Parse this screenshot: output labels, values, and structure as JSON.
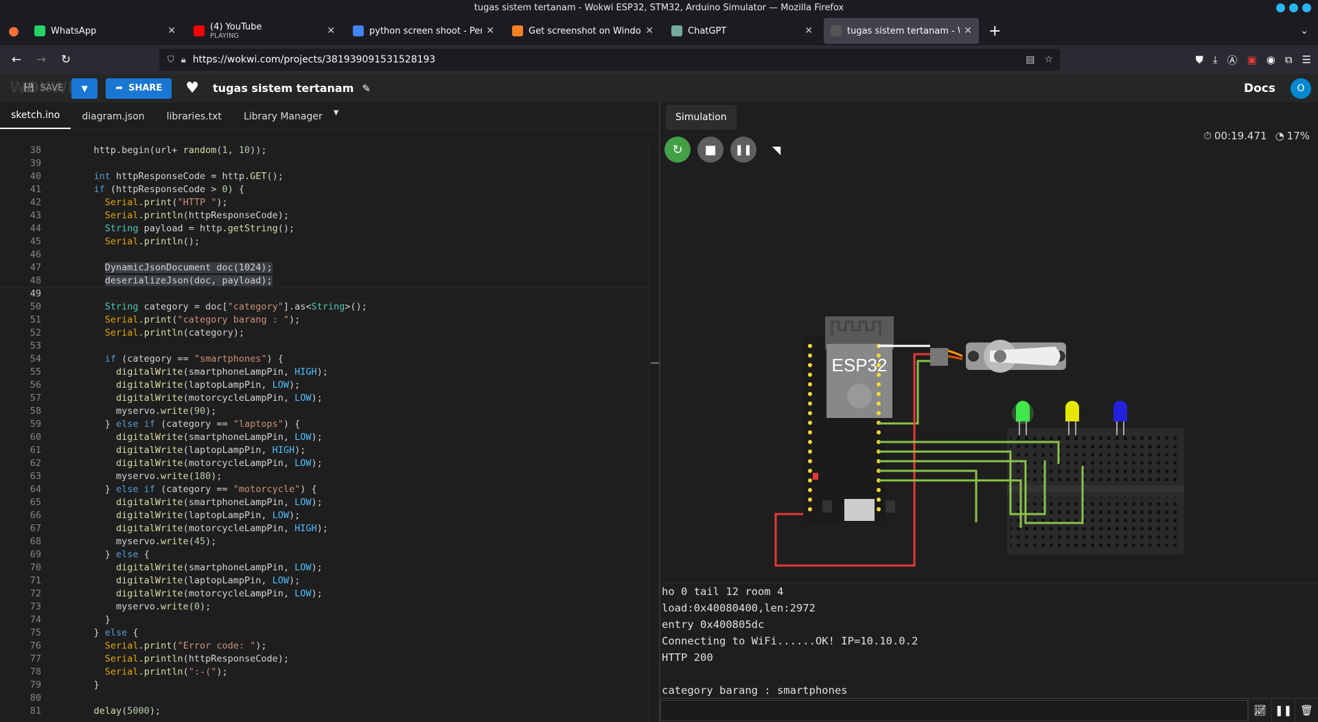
{
  "window": {
    "title": "tugas sistem tertanam - Wokwi ESP32, STM32, Arduino Simulator — Mozilla Firefox"
  },
  "tabs": [
    {
      "label": "WhatsApp",
      "icon": "whatsapp-icon",
      "color": "#25d366"
    },
    {
      "label": "(4) YouTube",
      "sub": "PLAYING",
      "icon": "youtube-icon",
      "color": "#ff0000"
    },
    {
      "label": "python screen shoot - Pen",
      "icon": "google-icon",
      "color": "#4285f4"
    },
    {
      "label": "Get screenshot on Window",
      "icon": "stackoverflow-icon",
      "color": "#f48024"
    },
    {
      "label": "ChatGPT",
      "icon": "chatgpt-icon",
      "color": "#74aa9c"
    },
    {
      "label": "tugas sistem tertanam - W",
      "icon": "wokwi-icon",
      "color": "#555555"
    }
  ],
  "url": "https://wokwi.com/projects/381939091531528193",
  "header": {
    "logo": "WOKWI",
    "save_label": "SAVE",
    "share_label": "SHARE",
    "project_title": "tugas sistem tertanam",
    "docs_label": "Docs",
    "avatar_letter": "O"
  },
  "editor_tabs": [
    "sketch.ino",
    "diagram.json",
    "libraries.txt",
    "Library Manager"
  ],
  "sim_tab": "Simulation",
  "timer": "00:19.471",
  "speed": "17%",
  "esp_label": "ESP32",
  "serial_lines": [
    "ho 0 tail 12 room 4",
    "load:0x40080400,len:2972",
    "entry 0x400805dc",
    "Connecting to WiFi......OK! IP=10.10.0.2",
    "HTTP 200",
    "",
    "category barang : smartphones"
  ],
  "code_start": 38,
  "code_lines": [
    [
      [
        "",
        "    http.begin(url+ "
      ],
      [
        "fn",
        "random"
      ],
      [
        "",
        "("
      ],
      [
        "num",
        "1"
      ],
      [
        "",
        ", "
      ],
      [
        "num",
        "10"
      ],
      [
        "",
        "));"
      ]
    ],
    [],
    [
      [
        "kw",
        "    int"
      ],
      [
        "",
        " httpResponseCode = http."
      ],
      [
        "fn",
        "GET"
      ],
      [
        "",
        "();"
      ]
    ],
    [
      [
        "kw",
        "    if"
      ],
      [
        "",
        " (httpResponseCode > "
      ],
      [
        "num",
        "0"
      ],
      [
        "",
        ") {"
      ]
    ],
    [
      [
        "obj",
        "      Serial"
      ],
      [
        "",
        "."
      ],
      [
        "fn",
        "print"
      ],
      [
        "",
        "("
      ],
      [
        "str",
        "\"HTTP \""
      ],
      [
        "",
        ");"
      ]
    ],
    [
      [
        "obj",
        "      Serial"
      ],
      [
        "",
        "."
      ],
      [
        "fn",
        "println"
      ],
      [
        "",
        "(httpResponseCode);"
      ]
    ],
    [
      [
        "ty",
        "      String"
      ],
      [
        "",
        " payload = http."
      ],
      [
        "fn",
        "getString"
      ],
      [
        "",
        "();"
      ]
    ],
    [
      [
        "obj",
        "      Serial"
      ],
      [
        "",
        "."
      ],
      [
        "fn",
        "println"
      ],
      [
        "",
        "();"
      ]
    ],
    [],
    [
      [
        "sel",
        "      DynamicJsonDocument doc(1024);"
      ]
    ],
    [
      [
        "sel",
        "      deserializeJson(doc, payload);"
      ]
    ],
    [],
    [
      [
        "ty",
        "      String"
      ],
      [
        "",
        " category = doc["
      ],
      [
        "str",
        "\"category\""
      ],
      [
        "",
        "].as<"
      ],
      [
        "ty",
        "String"
      ],
      [
        "",
        ">();"
      ]
    ],
    [
      [
        "obj",
        "      Serial"
      ],
      [
        "",
        "."
      ],
      [
        "fn",
        "print"
      ],
      [
        "",
        "("
      ],
      [
        "str",
        "\"category barang : \""
      ],
      [
        "",
        ");"
      ]
    ],
    [
      [
        "obj",
        "      Serial"
      ],
      [
        "",
        "."
      ],
      [
        "fn",
        "println"
      ],
      [
        "",
        "(category);"
      ]
    ],
    [],
    [
      [
        "kw",
        "      if"
      ],
      [
        "",
        " (category == "
      ],
      [
        "str",
        "\"smartphones\""
      ],
      [
        "",
        ") {"
      ]
    ],
    [
      [
        "fn",
        "        digitalWrite"
      ],
      [
        "",
        "(smartphoneLampPin, "
      ],
      [
        "cn",
        "HIGH"
      ],
      [
        "",
        ");"
      ]
    ],
    [
      [
        "fn",
        "        digitalWrite"
      ],
      [
        "",
        "(laptopLampPin, "
      ],
      [
        "cn",
        "LOW"
      ],
      [
        "",
        ");"
      ]
    ],
    [
      [
        "fn",
        "        digitalWrite"
      ],
      [
        "",
        "(motorcycleLampPin, "
      ],
      [
        "cn",
        "LOW"
      ],
      [
        "",
        ");"
      ]
    ],
    [
      [
        "",
        "        myservo."
      ],
      [
        "fn",
        "write"
      ],
      [
        "",
        "("
      ],
      [
        "num",
        "90"
      ],
      [
        "",
        ");"
      ]
    ],
    [
      [
        "",
        "      } "
      ],
      [
        "kw",
        "else if"
      ],
      [
        "",
        " (category == "
      ],
      [
        "str",
        "\"laptops\""
      ],
      [
        "",
        ") {"
      ]
    ],
    [
      [
        "fn",
        "        digitalWrite"
      ],
      [
        "",
        "(smartphoneLampPin, "
      ],
      [
        "cn",
        "LOW"
      ],
      [
        "",
        ");"
      ]
    ],
    [
      [
        "fn",
        "        digitalWrite"
      ],
      [
        "",
        "(laptopLampPin, "
      ],
      [
        "cn",
        "HIGH"
      ],
      [
        "",
        ");"
      ]
    ],
    [
      [
        "fn",
        "        digitalWrite"
      ],
      [
        "",
        "(motorcycleLampPin, "
      ],
      [
        "cn",
        "LOW"
      ],
      [
        "",
        ");"
      ]
    ],
    [
      [
        "",
        "        myservo."
      ],
      [
        "fn",
        "write"
      ],
      [
        "",
        "("
      ],
      [
        "num",
        "180"
      ],
      [
        "",
        ");"
      ]
    ],
    [
      [
        "",
        "      } "
      ],
      [
        "kw",
        "else if"
      ],
      [
        "",
        " (category == "
      ],
      [
        "str",
        "\"motorcycle\""
      ],
      [
        "",
        ") {"
      ]
    ],
    [
      [
        "fn",
        "        digitalWrite"
      ],
      [
        "",
        "(smartphoneLampPin, "
      ],
      [
        "cn",
        "LOW"
      ],
      [
        "",
        ");"
      ]
    ],
    [
      [
        "fn",
        "        digitalWrite"
      ],
      [
        "",
        "(laptopLampPin, "
      ],
      [
        "cn",
        "LOW"
      ],
      [
        "",
        ");"
      ]
    ],
    [
      [
        "fn",
        "        digitalWrite"
      ],
      [
        "",
        "(motorcycleLampPin, "
      ],
      [
        "cn",
        "HIGH"
      ],
      [
        "",
        ");"
      ]
    ],
    [
      [
        "",
        "        myservo."
      ],
      [
        "fn",
        "write"
      ],
      [
        "",
        "("
      ],
      [
        "num",
        "45"
      ],
      [
        "",
        ");"
      ]
    ],
    [
      [
        "",
        "      } "
      ],
      [
        "kw",
        "else"
      ],
      [
        "",
        " {"
      ]
    ],
    [
      [
        "fn",
        "        digitalWrite"
      ],
      [
        "",
        "(smartphoneLampPin, "
      ],
      [
        "cn",
        "LOW"
      ],
      [
        "",
        ");"
      ]
    ],
    [
      [
        "fn",
        "        digitalWrite"
      ],
      [
        "",
        "(laptopLampPin, "
      ],
      [
        "cn",
        "LOW"
      ],
      [
        "",
        ");"
      ]
    ],
    [
      [
        "fn",
        "        digitalWrite"
      ],
      [
        "",
        "(motorcycleLampPin, "
      ],
      [
        "cn",
        "LOW"
      ],
      [
        "",
        ");"
      ]
    ],
    [
      [
        "",
        "        myservo."
      ],
      [
        "fn",
        "write"
      ],
      [
        "",
        "("
      ],
      [
        "num",
        "0"
      ],
      [
        "",
        ");"
      ]
    ],
    [
      [
        "",
        "      }"
      ]
    ],
    [
      [
        "",
        "    } "
      ],
      [
        "kw",
        "else"
      ],
      [
        "",
        " {"
      ]
    ],
    [
      [
        "obj",
        "      Serial"
      ],
      [
        "",
        "."
      ],
      [
        "fn",
        "print"
      ],
      [
        "",
        "("
      ],
      [
        "str",
        "\"Error code: \""
      ],
      [
        "",
        ");"
      ]
    ],
    [
      [
        "obj",
        "      Serial"
      ],
      [
        "",
        "."
      ],
      [
        "fn",
        "println"
      ],
      [
        "",
        "(httpResponseCode);"
      ]
    ],
    [
      [
        "obj",
        "      Serial"
      ],
      [
        "",
        "."
      ],
      [
        "fn",
        "println"
      ],
      [
        "",
        "("
      ],
      [
        "str",
        "\":-(\""
      ],
      [
        "",
        ");"
      ]
    ],
    [
      [
        "",
        "    }"
      ]
    ],
    [],
    [
      [
        "fn",
        "    delay"
      ],
      [
        "",
        "("
      ],
      [
        "num",
        "5000"
      ],
      [
        "",
        ");"
      ]
    ]
  ]
}
